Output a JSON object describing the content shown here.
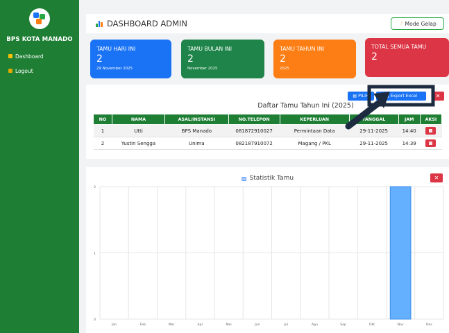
{
  "sidebar": {
    "brand": "BPS KOTA MANADO",
    "items": [
      {
        "label": "Dashboard",
        "icon": "home-icon"
      },
      {
        "label": "Logout",
        "icon": "logout-icon"
      }
    ]
  },
  "header": {
    "title": "DASHBOARD ADMIN",
    "mode_label": "Mode Gelap"
  },
  "cards": [
    {
      "title": "TAMU HARI INI",
      "value": "2",
      "sub": "29 November 2025",
      "color": "#1a73f5"
    },
    {
      "title": "TAMU BULAN INI",
      "value": "2",
      "sub": "November 2025",
      "color": "#1e8449"
    },
    {
      "title": "TAMU TAHUN INI",
      "value": "2",
      "sub": "2025",
      "color": "#fd7e14"
    },
    {
      "title": "TOTAL SEMUA TAMU",
      "value": "2",
      "sub": "",
      "color": "#dc3545"
    }
  ],
  "guest_table": {
    "title": "Daftar Tamu Tahun Ini (2025)",
    "pilih_label": "PILIH",
    "export_label": "Export Excel",
    "close_label": "✕",
    "columns": [
      "NO",
      "NAMA",
      "ASAL/INSTANSI",
      "NO.TELEPON",
      "KEPERLUAN",
      "TANGGAL",
      "JAM",
      "AKSI"
    ],
    "rows": [
      [
        "1",
        "Utti",
        "BPS Manado",
        "081872910027",
        "Permintaan Data",
        "29-11-2025",
        "14:40"
      ],
      [
        "2",
        "Yustin Sengga",
        "Unima",
        "082187910072",
        "Magang / PKL",
        "29-11-2025",
        "14:39"
      ]
    ]
  },
  "chart_panel": {
    "title": "Statistik Tamu",
    "close_label": "✕"
  },
  "chart_data": {
    "type": "bar",
    "title": "Statistik Tamu",
    "categories": [
      "Jan",
      "Feb",
      "Mar",
      "Apr",
      "Mei",
      "Jun",
      "Jul",
      "Agu",
      "Sep",
      "Okt",
      "Nov",
      "Des"
    ],
    "values": [
      0,
      0,
      0,
      0,
      0,
      0,
      0,
      0,
      0,
      0,
      2,
      0
    ],
    "ylim": [
      0,
      2
    ],
    "yticks": [
      "0",
      "1",
      "2"
    ],
    "bar_color": "#64b0ff",
    "grid": true
  }
}
